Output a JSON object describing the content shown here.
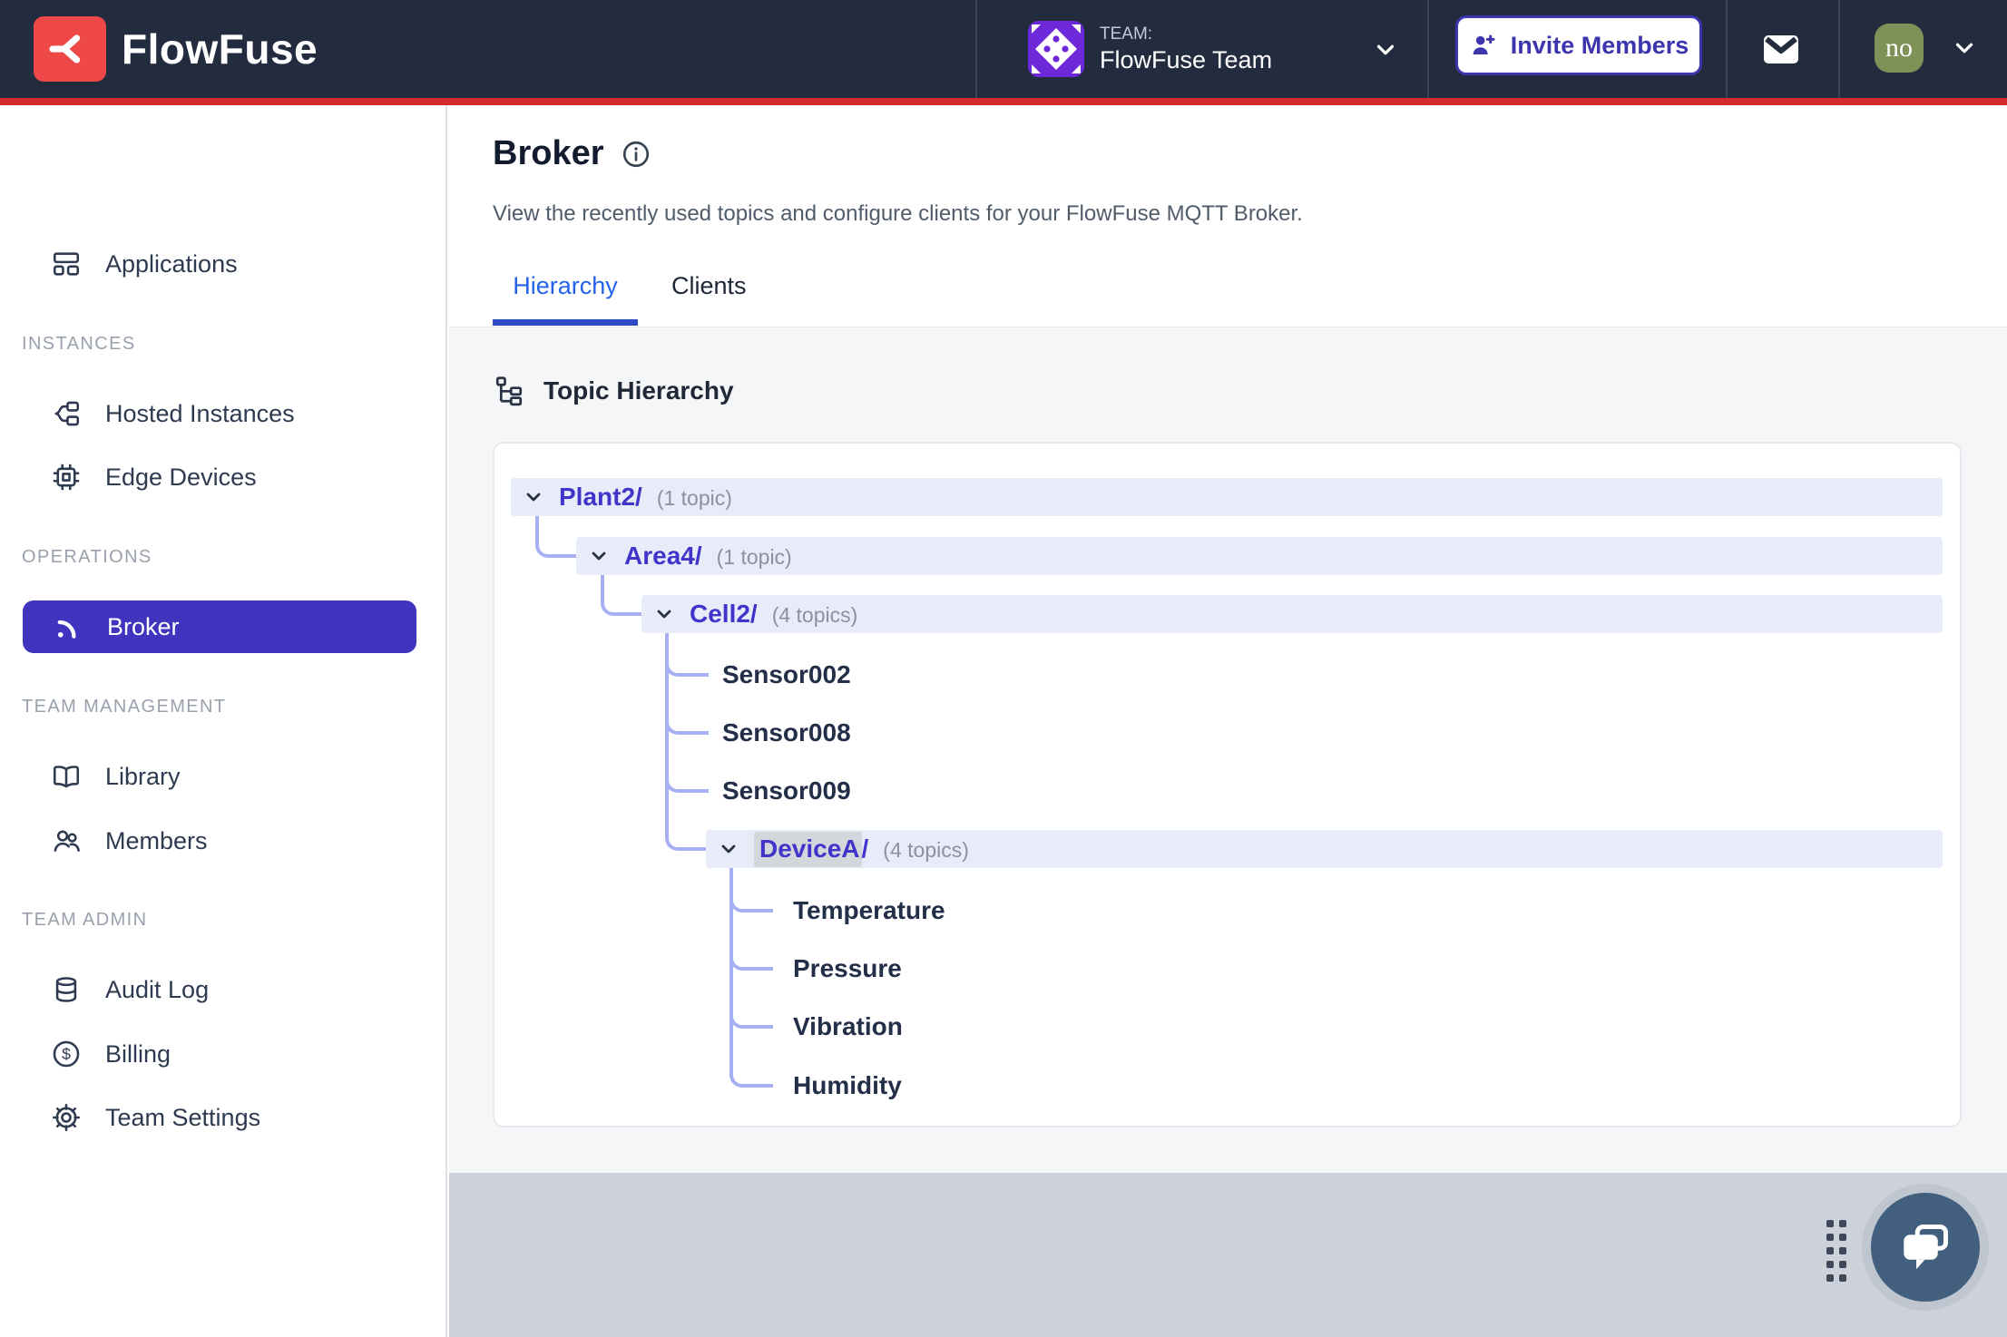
{
  "navbar": {
    "brand": "FlowFuse",
    "team_label": "TEAM:",
    "team_name": "FlowFuse Team",
    "invite_button_label": "Invite Members",
    "user_avatar_text": "no"
  },
  "sidebar": {
    "sections": [
      {
        "label": "",
        "items": [
          {
            "label": "Applications",
            "icon": "applications-icon"
          }
        ]
      },
      {
        "label": "INSTANCES",
        "items": [
          {
            "label": "Hosted Instances",
            "icon": "hosted-instances-icon"
          },
          {
            "label": "Edge Devices",
            "icon": "edge-devices-icon"
          }
        ]
      },
      {
        "label": "OPERATIONS",
        "items": [
          {
            "label": "Broker",
            "icon": "broker-rss-icon",
            "active": true
          }
        ]
      },
      {
        "label": "TEAM MANAGEMENT",
        "items": [
          {
            "label": "Library",
            "icon": "library-icon"
          },
          {
            "label": "Members",
            "icon": "members-icon"
          }
        ]
      },
      {
        "label": "TEAM ADMIN",
        "items": [
          {
            "label": "Audit Log",
            "icon": "audit-log-icon"
          },
          {
            "label": "Billing",
            "icon": "billing-icon"
          },
          {
            "label": "Team Settings",
            "icon": "settings-icon"
          }
        ]
      }
    ]
  },
  "page": {
    "title": "Broker",
    "description": "View the recently used topics and configure clients for your FlowFuse MQTT Broker.",
    "tabs": [
      {
        "label": "Hierarchy",
        "active": true
      },
      {
        "label": "Clients",
        "active": false
      }
    ],
    "section_title": "Topic Hierarchy"
  },
  "tree": {
    "rows": [
      {
        "label": "Plant2/",
        "count": "(1 topic)",
        "type": "branch",
        "depth": 0
      },
      {
        "label": "Area4/",
        "count": "(1 topic)",
        "type": "branch",
        "depth": 1
      },
      {
        "label": "Cell2/",
        "count": "(4 topics)",
        "type": "branch",
        "depth": 2
      },
      {
        "label": "Sensor002",
        "type": "leaf",
        "depth": 3
      },
      {
        "label": "Sensor008",
        "type": "leaf",
        "depth": 3
      },
      {
        "label": "Sensor009",
        "type": "leaf",
        "depth": 3
      },
      {
        "label": "DeviceA",
        "suffix": "/",
        "count": "(4 topics)",
        "type": "branch",
        "depth": 3,
        "text_selected": true
      },
      {
        "label": "Temperature",
        "type": "leaf",
        "depth": 4
      },
      {
        "label": "Pressure",
        "type": "leaf",
        "depth": 4
      },
      {
        "label": "Vibration",
        "type": "leaf",
        "depth": 4
      },
      {
        "label": "Humidity",
        "type": "leaf",
        "depth": 4
      }
    ]
  },
  "colors": {
    "navbar_bg": "#222c3e",
    "accent_red": "#d32b2b",
    "logo_red": "#ee4948",
    "active_nav_bg": "#4034bf",
    "tree_label_indigo": "#4134cb",
    "tree_row_bg": "#e8ecf9",
    "connector": "#a5aff2",
    "active_tab_text": "#2563eb",
    "active_tab_underline": "#2d4cc5",
    "team_avatar_purple": "#6d28d9",
    "user_avatar_olive": "#7e9156",
    "footer_band": "#cdd2da",
    "chat_button": "#42607e"
  }
}
